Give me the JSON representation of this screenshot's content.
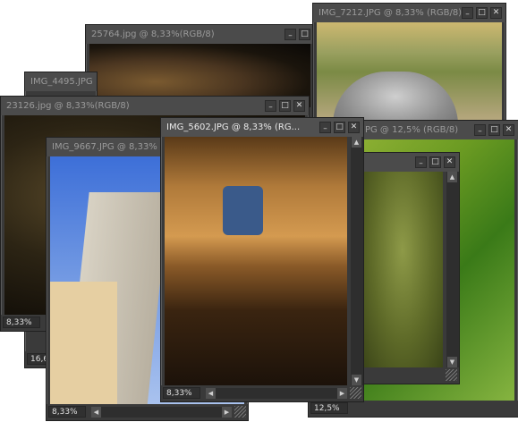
{
  "windows": [
    {
      "title": "25764.jpg @ 8,33%(RGB/8)",
      "zoom": ""
    },
    {
      "title": "IMG_7212.JPG @ 8,33% (RGB/8)",
      "zoom": ""
    },
    {
      "title": "IMG_4495.JPG",
      "zoom": "16,6"
    },
    {
      "title": "23126.jpg @ 8,33%(RGB/8)",
      "zoom": "8,33%"
    },
    {
      "title": "JPG @ 12,5% (RGB/8)",
      "zoom": "12,5%"
    },
    {
      "title": "IMG_9667.JPG @ 8,33% (RGB/8)",
      "zoom": "8,33%"
    },
    {
      "title": "",
      "zoom": ""
    },
    {
      "title": "IMG_5602.JPG @ 8,33% (RG...",
      "zoom": "8,33%"
    }
  ],
  "icons": {
    "minimize": "–",
    "maximize": "□",
    "close": "✕",
    "arrow_left": "◀",
    "arrow_right": "▶",
    "arrow_up": "▲",
    "arrow_down": "▼"
  }
}
